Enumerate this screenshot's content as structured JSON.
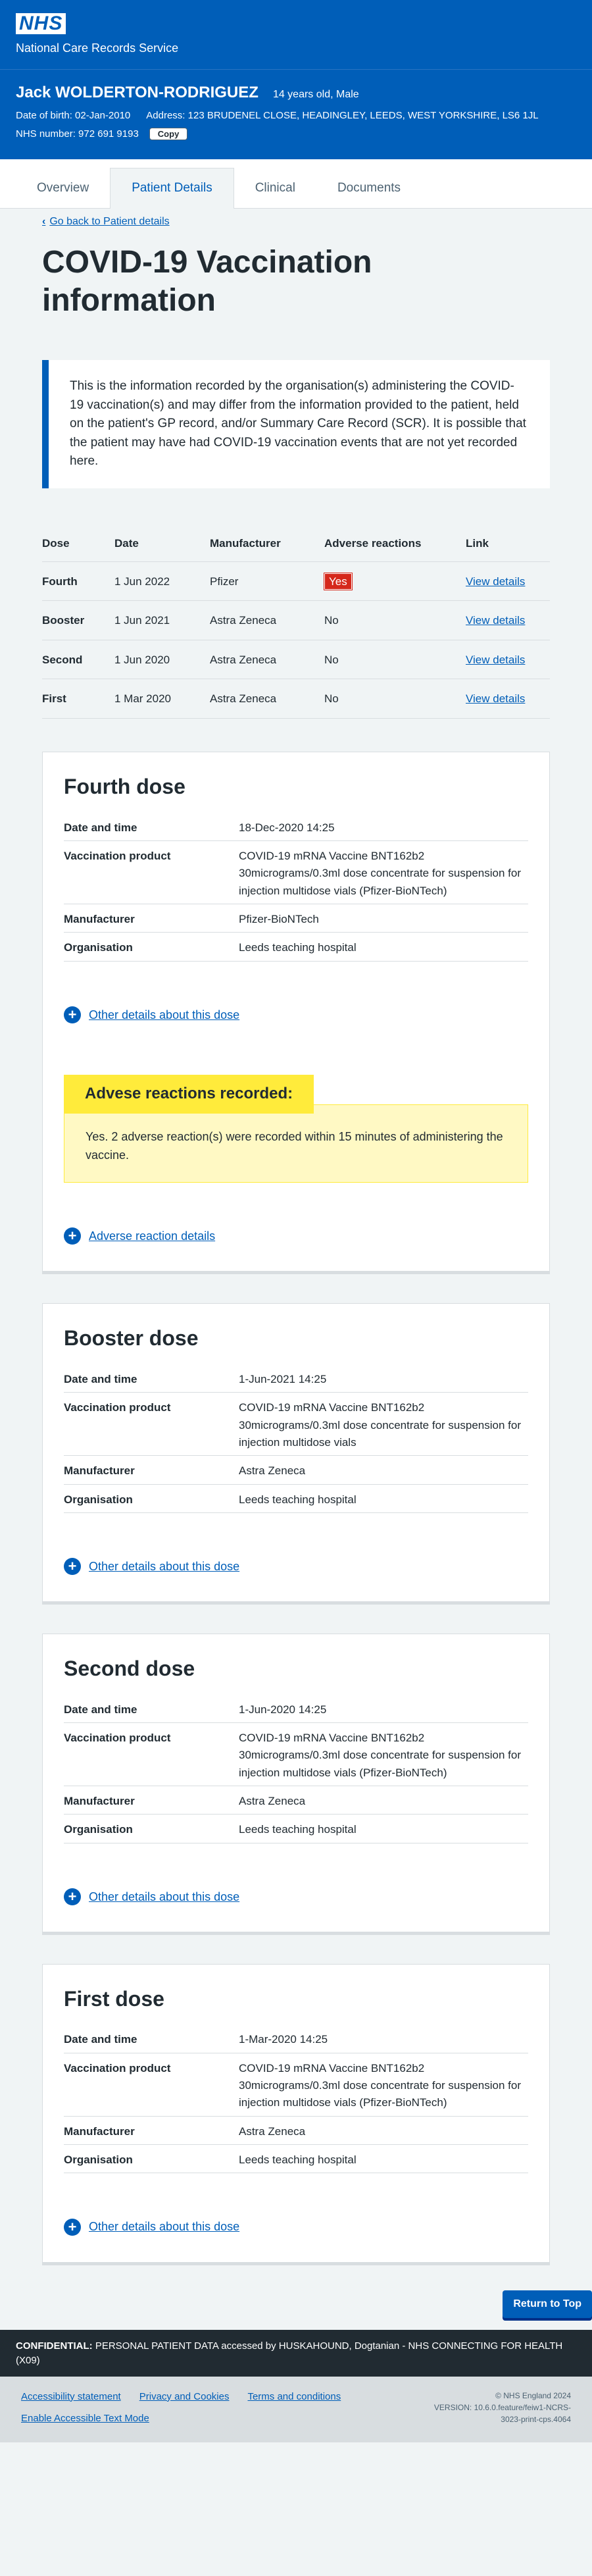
{
  "header": {
    "logo": "NHS",
    "service": "National Care Records Service"
  },
  "patient": {
    "name": "Jack WOLDERTON-RODRIGUEZ",
    "age_sex": "14 years old, Male",
    "dob": "Date of birth: 02-Jan-2010",
    "address": "Address: 123 BRUDENEL CLOSE, HEADINGLEY, LEEDS, WEST YORKSHIRE, LS6 1JL",
    "nhs_number": "NHS number: 972 691 9193",
    "copy_label": "Copy"
  },
  "tabs": [
    {
      "label": "Overview"
    },
    {
      "label": "Patient Details"
    },
    {
      "label": "Clinical"
    },
    {
      "label": "Documents"
    }
  ],
  "back_link": "Go back to Patient details",
  "title": "COVID-19 Vaccination information",
  "inset_text": "This is the information recorded by the organisation(s) administering the COVID-19 vaccination(s) and may differ from the information provided to the patient, held on the patient's GP record, and/or Summary Care Record (SCR). It is possible that the patient may have had COVID-19 vaccination events that are not yet recorded here.",
  "summary": {
    "headers": [
      "Dose",
      "Date",
      "Manufacturer",
      "Adverse reactions",
      "Link"
    ],
    "rows": [
      {
        "dose": "Fourth",
        "date": "1 Jun 2022",
        "manufacturer": "Pfizer",
        "adverse": "Yes",
        "link": "View details"
      },
      {
        "dose": "Booster",
        "date": "1 Jun 2021",
        "manufacturer": "Astra Zeneca",
        "adverse": "No",
        "link": "View details"
      },
      {
        "dose": "Second",
        "date": "1 Jun 2020",
        "manufacturer": "Astra Zeneca",
        "adverse": "No",
        "link": "View details"
      },
      {
        "dose": "First",
        "date": "1 Mar 2020",
        "manufacturer": "Astra Zeneca",
        "adverse": "No",
        "link": "View details"
      }
    ]
  },
  "labels": {
    "date_time": "Date and time",
    "product": "Vaccination product",
    "manufacturer": "Manufacturer",
    "organisation": "Organisation",
    "other_details": "Other details about this dose",
    "adverse_details": "Adverse reaction details"
  },
  "doses": [
    {
      "title": "Fourth dose",
      "date_time": "18-Dec-2020 14:25",
      "product": "COVID-19 mRNA Vaccine BNT162b2 30micrograms/0.3ml dose concentrate for suspension for injection multidose vials (Pfizer-BioNTech)",
      "manufacturer": "Pfizer-BioNTech",
      "organisation": "Leeds teaching hospital"
    },
    {
      "title": "Booster dose",
      "date_time": "1-Jun-2021 14:25",
      "product": "COVID-19 mRNA Vaccine BNT162b2 30micrograms/0.3ml dose concentrate for suspension for injection multidose vials",
      "manufacturer": "Astra Zeneca",
      "organisation": "Leeds teaching hospital"
    },
    {
      "title": "Second dose",
      "date_time": "1-Jun-2020 14:25",
      "product": "COVID-19 mRNA Vaccine BNT162b2 30micrograms/0.3ml dose concentrate for suspension for injection multidose vials (Pfizer-BioNTech)",
      "manufacturer": "Astra Zeneca",
      "organisation": "Leeds teaching hospital"
    },
    {
      "title": "First dose",
      "date_time": "1-Mar-2020 14:25",
      "product": "COVID-19 mRNA Vaccine BNT162b2 30micrograms/0.3ml dose concentrate for suspension for injection multidose vials (Pfizer-BioNTech)",
      "manufacturer": "Astra Zeneca",
      "organisation": "Leeds teaching hospital"
    }
  ],
  "adverse_warning": {
    "label": "Advese reactions recorded:",
    "text": "Yes. 2 adverse reaction(s) were recorded within 15 minutes of administering the vaccine."
  },
  "return_top": "Return to Top",
  "confidential": {
    "prefix": "CONFIDENTIAL:",
    "text": " PERSONAL PATIENT DATA accessed by HUSKAHOUND, Dogtanian - NHS CONNECTING FOR HEALTH (X09)"
  },
  "footer": {
    "links": [
      "Accessibility statement",
      "Privacy and Cookies",
      "Terms and conditions",
      "Enable Accessible Text Mode"
    ],
    "copyright": "© NHS England 2024",
    "version": "VERSION: 10.6.0.feature/feiw1-NCRS-3023-print-cps.4064"
  },
  "colors": {
    "brand": "#005eb8",
    "warning": "#ffeb3b",
    "danger": "#d5281b"
  }
}
